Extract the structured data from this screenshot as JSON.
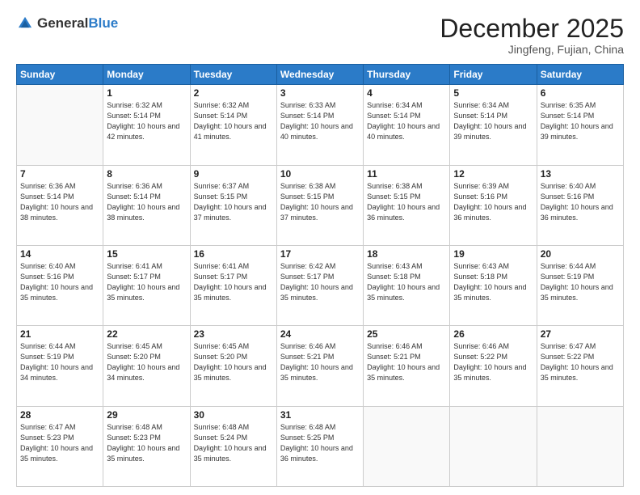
{
  "logo": {
    "general": "General",
    "blue": "Blue"
  },
  "header": {
    "month": "December 2025",
    "location": "Jingfeng, Fujian, China"
  },
  "weekdays": [
    "Sunday",
    "Monday",
    "Tuesday",
    "Wednesday",
    "Thursday",
    "Friday",
    "Saturday"
  ],
  "weeks": [
    [
      {
        "day": "",
        "sunrise": "",
        "sunset": "",
        "daylight": ""
      },
      {
        "day": "1",
        "sunrise": "Sunrise: 6:32 AM",
        "sunset": "Sunset: 5:14 PM",
        "daylight": "Daylight: 10 hours and 42 minutes."
      },
      {
        "day": "2",
        "sunrise": "Sunrise: 6:32 AM",
        "sunset": "Sunset: 5:14 PM",
        "daylight": "Daylight: 10 hours and 41 minutes."
      },
      {
        "day": "3",
        "sunrise": "Sunrise: 6:33 AM",
        "sunset": "Sunset: 5:14 PM",
        "daylight": "Daylight: 10 hours and 40 minutes."
      },
      {
        "day": "4",
        "sunrise": "Sunrise: 6:34 AM",
        "sunset": "Sunset: 5:14 PM",
        "daylight": "Daylight: 10 hours and 40 minutes."
      },
      {
        "day": "5",
        "sunrise": "Sunrise: 6:34 AM",
        "sunset": "Sunset: 5:14 PM",
        "daylight": "Daylight: 10 hours and 39 minutes."
      },
      {
        "day": "6",
        "sunrise": "Sunrise: 6:35 AM",
        "sunset": "Sunset: 5:14 PM",
        "daylight": "Daylight: 10 hours and 39 minutes."
      }
    ],
    [
      {
        "day": "7",
        "sunrise": "Sunrise: 6:36 AM",
        "sunset": "Sunset: 5:14 PM",
        "daylight": "Daylight: 10 hours and 38 minutes."
      },
      {
        "day": "8",
        "sunrise": "Sunrise: 6:36 AM",
        "sunset": "Sunset: 5:14 PM",
        "daylight": "Daylight: 10 hours and 38 minutes."
      },
      {
        "day": "9",
        "sunrise": "Sunrise: 6:37 AM",
        "sunset": "Sunset: 5:15 PM",
        "daylight": "Daylight: 10 hours and 37 minutes."
      },
      {
        "day": "10",
        "sunrise": "Sunrise: 6:38 AM",
        "sunset": "Sunset: 5:15 PM",
        "daylight": "Daylight: 10 hours and 37 minutes."
      },
      {
        "day": "11",
        "sunrise": "Sunrise: 6:38 AM",
        "sunset": "Sunset: 5:15 PM",
        "daylight": "Daylight: 10 hours and 36 minutes."
      },
      {
        "day": "12",
        "sunrise": "Sunrise: 6:39 AM",
        "sunset": "Sunset: 5:16 PM",
        "daylight": "Daylight: 10 hours and 36 minutes."
      },
      {
        "day": "13",
        "sunrise": "Sunrise: 6:40 AM",
        "sunset": "Sunset: 5:16 PM",
        "daylight": "Daylight: 10 hours and 36 minutes."
      }
    ],
    [
      {
        "day": "14",
        "sunrise": "Sunrise: 6:40 AM",
        "sunset": "Sunset: 5:16 PM",
        "daylight": "Daylight: 10 hours and 35 minutes."
      },
      {
        "day": "15",
        "sunrise": "Sunrise: 6:41 AM",
        "sunset": "Sunset: 5:17 PM",
        "daylight": "Daylight: 10 hours and 35 minutes."
      },
      {
        "day": "16",
        "sunrise": "Sunrise: 6:41 AM",
        "sunset": "Sunset: 5:17 PM",
        "daylight": "Daylight: 10 hours and 35 minutes."
      },
      {
        "day": "17",
        "sunrise": "Sunrise: 6:42 AM",
        "sunset": "Sunset: 5:17 PM",
        "daylight": "Daylight: 10 hours and 35 minutes."
      },
      {
        "day": "18",
        "sunrise": "Sunrise: 6:43 AM",
        "sunset": "Sunset: 5:18 PM",
        "daylight": "Daylight: 10 hours and 35 minutes."
      },
      {
        "day": "19",
        "sunrise": "Sunrise: 6:43 AM",
        "sunset": "Sunset: 5:18 PM",
        "daylight": "Daylight: 10 hours and 35 minutes."
      },
      {
        "day": "20",
        "sunrise": "Sunrise: 6:44 AM",
        "sunset": "Sunset: 5:19 PM",
        "daylight": "Daylight: 10 hours and 35 minutes."
      }
    ],
    [
      {
        "day": "21",
        "sunrise": "Sunrise: 6:44 AM",
        "sunset": "Sunset: 5:19 PM",
        "daylight": "Daylight: 10 hours and 34 minutes."
      },
      {
        "day": "22",
        "sunrise": "Sunrise: 6:45 AM",
        "sunset": "Sunset: 5:20 PM",
        "daylight": "Daylight: 10 hours and 34 minutes."
      },
      {
        "day": "23",
        "sunrise": "Sunrise: 6:45 AM",
        "sunset": "Sunset: 5:20 PM",
        "daylight": "Daylight: 10 hours and 35 minutes."
      },
      {
        "day": "24",
        "sunrise": "Sunrise: 6:46 AM",
        "sunset": "Sunset: 5:21 PM",
        "daylight": "Daylight: 10 hours and 35 minutes."
      },
      {
        "day": "25",
        "sunrise": "Sunrise: 6:46 AM",
        "sunset": "Sunset: 5:21 PM",
        "daylight": "Daylight: 10 hours and 35 minutes."
      },
      {
        "day": "26",
        "sunrise": "Sunrise: 6:46 AM",
        "sunset": "Sunset: 5:22 PM",
        "daylight": "Daylight: 10 hours and 35 minutes."
      },
      {
        "day": "27",
        "sunrise": "Sunrise: 6:47 AM",
        "sunset": "Sunset: 5:22 PM",
        "daylight": "Daylight: 10 hours and 35 minutes."
      }
    ],
    [
      {
        "day": "28",
        "sunrise": "Sunrise: 6:47 AM",
        "sunset": "Sunset: 5:23 PM",
        "daylight": "Daylight: 10 hours and 35 minutes."
      },
      {
        "day": "29",
        "sunrise": "Sunrise: 6:48 AM",
        "sunset": "Sunset: 5:23 PM",
        "daylight": "Daylight: 10 hours and 35 minutes."
      },
      {
        "day": "30",
        "sunrise": "Sunrise: 6:48 AM",
        "sunset": "Sunset: 5:24 PM",
        "daylight": "Daylight: 10 hours and 35 minutes."
      },
      {
        "day": "31",
        "sunrise": "Sunrise: 6:48 AM",
        "sunset": "Sunset: 5:25 PM",
        "daylight": "Daylight: 10 hours and 36 minutes."
      },
      {
        "day": "",
        "sunrise": "",
        "sunset": "",
        "daylight": ""
      },
      {
        "day": "",
        "sunrise": "",
        "sunset": "",
        "daylight": ""
      },
      {
        "day": "",
        "sunrise": "",
        "sunset": "",
        "daylight": ""
      }
    ]
  ]
}
